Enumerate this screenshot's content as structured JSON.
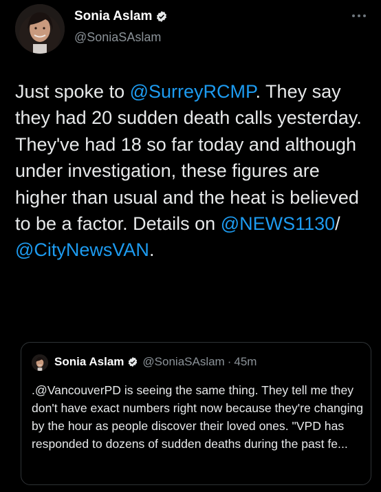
{
  "tweet": {
    "author_name": "Sonia Aslam",
    "handle": "@SoniaSAslam",
    "more_icon": "more-horizontal-icon",
    "body": {
      "t1": "Just spoke to ",
      "m1": "@SurreyRCMP",
      "t2": ". They say they had 20 sudden death calls yesterday. They've had 18 so far today and although under investigation, these figures are higher than usual and the heat is believed to be a factor. Details on ",
      "m2": "@NEWS1130",
      "t3": "/ ",
      "m3": "@CityNewsVAN",
      "t4": "."
    }
  },
  "quoted_tweet": {
    "author_name": "Sonia Aslam",
    "handle": "@SoniaSAslam",
    "separator": "·",
    "time": "45m",
    "text": ".@VancouverPD is seeing the same thing. They tell me they don't have exact numbers right now because they're changing by the hour as people discover their loved ones. \"VPD has responded to dozens of sudden deaths during the past fe..."
  },
  "colors": {
    "background": "#000000",
    "text": "#e7e9ea",
    "secondary": "#8b9298",
    "link": "#1d9bf0"
  }
}
